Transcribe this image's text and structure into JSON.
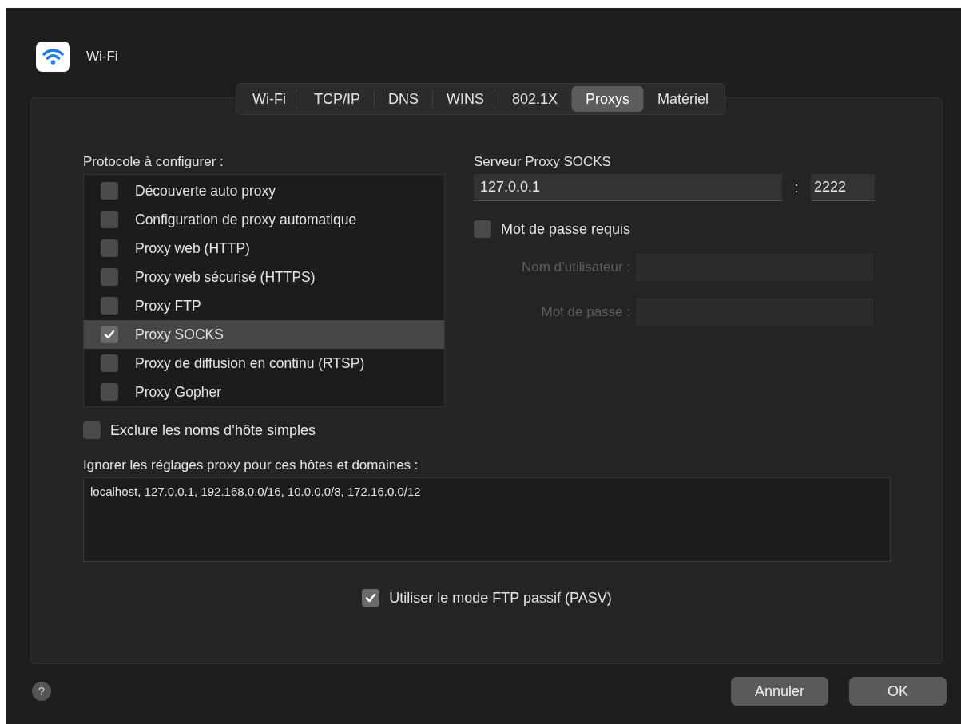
{
  "window": {
    "title": "Wi-Fi"
  },
  "tabs": [
    {
      "label": "Wi-Fi",
      "selected": false
    },
    {
      "label": "TCP/IP",
      "selected": false
    },
    {
      "label": "DNS",
      "selected": false
    },
    {
      "label": "WINS",
      "selected": false
    },
    {
      "label": "802.1X",
      "selected": false
    },
    {
      "label": "Proxys",
      "selected": true
    },
    {
      "label": "Matériel",
      "selected": false
    }
  ],
  "protocols": {
    "label": "Protocole à configurer :",
    "items": [
      {
        "label": "Découverte auto proxy",
        "checked": false,
        "selected": false
      },
      {
        "label": "Configuration de proxy automatique",
        "checked": false,
        "selected": false
      },
      {
        "label": "Proxy web (HTTP)",
        "checked": false,
        "selected": false
      },
      {
        "label": "Proxy web sécurisé (HTTPS)",
        "checked": false,
        "selected": false
      },
      {
        "label": "Proxy FTP",
        "checked": false,
        "selected": false
      },
      {
        "label": "Proxy SOCKS",
        "checked": true,
        "selected": true
      },
      {
        "label": "Proxy de diffusion en continu (RTSP)",
        "checked": false,
        "selected": false
      },
      {
        "label": "Proxy Gopher",
        "checked": false,
        "selected": false
      }
    ]
  },
  "server": {
    "label": "Serveur Proxy SOCKS",
    "host": "127.0.0.1",
    "separator": ":",
    "port": "2222",
    "password_required": {
      "label": "Mot de passe requis",
      "checked": false
    },
    "username": {
      "label": "Nom d’utilisateur :",
      "disabled": true
    },
    "password": {
      "label": "Mot de passe :",
      "disabled": true
    }
  },
  "exclude_simple": {
    "label": "Exclure les noms d’hôte simples",
    "checked": false
  },
  "bypass": {
    "label": "Ignorer les réglages proxy pour ces hôtes et domaines :",
    "value": "localhost, 127.0.0.1, 192.168.0.0/16, 10.0.0.0/8, 172.16.0.0/12"
  },
  "passive_ftp": {
    "label": "Utiliser le mode FTP passif (PASV)",
    "checked": true
  },
  "help": "?",
  "buttons": [
    "Annuler",
    "OK"
  ]
}
